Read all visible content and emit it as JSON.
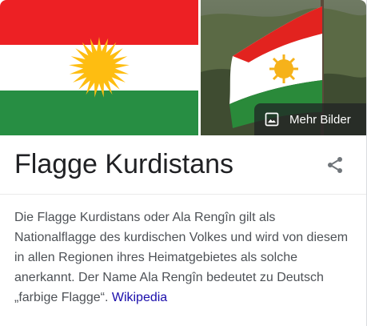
{
  "knowledge_panel": {
    "images": {
      "flag_alt": "Flagge Kurdistans",
      "photo_alt": "Kurdische Flagge im Wind",
      "more_images_label": "Mehr Bilder"
    },
    "title": "Flagge Kurdistans",
    "description": "Die Flagge Kurdistans oder Ala Rengîn gilt als Nationalflagge des kurdischen Volkes und wird von diesem in allen Regionen ihres Heimatgebietes als solche anerkannt. Der Name Ala Rengîn bedeutet zu Deutsch „farbige Flagge“.",
    "source_link": "Wikipedia"
  },
  "colors": {
    "flag_red": "#ed2024",
    "flag_white": "#ffffff",
    "flag_green": "#278e43",
    "sun_yellow": "#febd11",
    "link": "#1a0dab"
  },
  "icons": {
    "more_images": "image-icon",
    "share": "share-icon"
  }
}
